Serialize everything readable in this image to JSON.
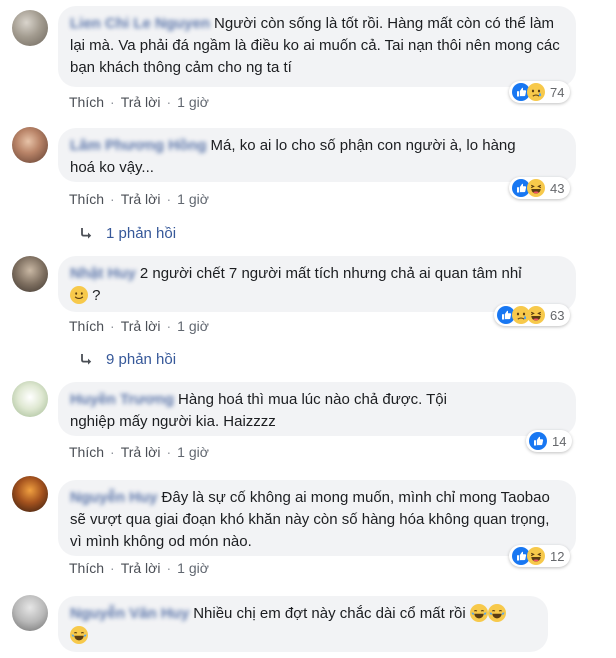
{
  "comments": [
    {
      "author": "Lien Chi Le Nguyen",
      "text": "Người còn sống là tốt rồi. Hàng mất còn có thể làm lại mà. Va phải đá ngầm là điều ko ai muốn cả. Tai nạn thôi nên mong các bạn khách thông cảm cho ng ta tí",
      "like": "Thích",
      "reply": "Trả lời",
      "time": "1 giờ",
      "reactions": [
        "like",
        "sad"
      ],
      "count": "74"
    },
    {
      "author": "Lâm Phương Hồng",
      "text": "Má, ko ai lo cho số phận con người à, lo hàng hoá ko vậy...",
      "like": "Thích",
      "reply": "Trả lời",
      "time": "1 giờ",
      "reactions": [
        "like",
        "haha"
      ],
      "count": "43",
      "replies": "1 phản hồi"
    },
    {
      "author": "Nhật Huy",
      "text": "2 người chết 7 người mất tích nhưng chả ai quan tâm nhỉ",
      "text_suffix": "?",
      "like": "Thích",
      "reply": "Trả lời",
      "time": "1 giờ",
      "reactions": [
        "like",
        "sad",
        "haha"
      ],
      "count": "63",
      "replies": "9 phản hồi"
    },
    {
      "author": "Huyền Trương",
      "text": "Hàng hoá thì mua lúc nào chả được. Tội nghiệp mấy người kia. Haizzzz",
      "like": "Thích",
      "reply": "Trả lời",
      "time": "1 giờ",
      "reactions": [
        "like"
      ],
      "count": "14"
    },
    {
      "author": "Nguyễn Huy",
      "text": "Đây là sự cố không ai mong muốn, mình chỉ mong Taobao sẽ vượt qua giai đoạn khó khăn này còn số hàng hóa không quan trọng, vì mình không od món nào.",
      "like": "Thích",
      "reply": "Trả lời",
      "time": "1 giờ",
      "reactions": [
        "like",
        "haha"
      ],
      "count": "12"
    },
    {
      "author": "Nguyễn Văn Huy",
      "text": "Nhiều chị em đợt này chắc dài cổ mất rồi"
    }
  ]
}
